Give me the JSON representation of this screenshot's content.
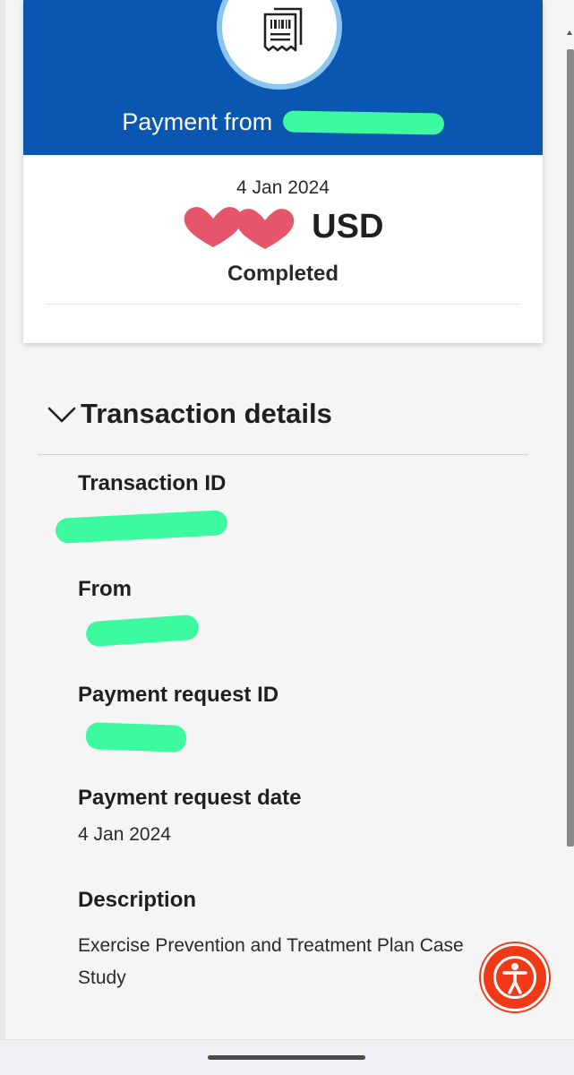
{
  "header": {
    "payment_from_label": "Payment from",
    "receipt_icon": "receipt-icon",
    "colors": {
      "header_bg": "#0a57b2",
      "icon_ring": "#8cc6f0"
    }
  },
  "summary": {
    "date": "4 Jan 2024",
    "amount_currency": "USD",
    "status": "Completed"
  },
  "details": {
    "section_title": "Transaction details",
    "toggle_icon": "chevron-down-icon",
    "fields": {
      "transaction_id_label": "Transaction ID",
      "from_label": "From",
      "payment_request_id_label": "Payment request ID",
      "payment_request_date_label": "Payment request date",
      "payment_request_date_value": "4 Jan 2024",
      "description_label": "Description",
      "description_value": "Exercise Prevention and Treatment Plan Case Study"
    }
  },
  "accessibility_button": {
    "icon": "accessibility-icon",
    "color": "#f03a17"
  }
}
